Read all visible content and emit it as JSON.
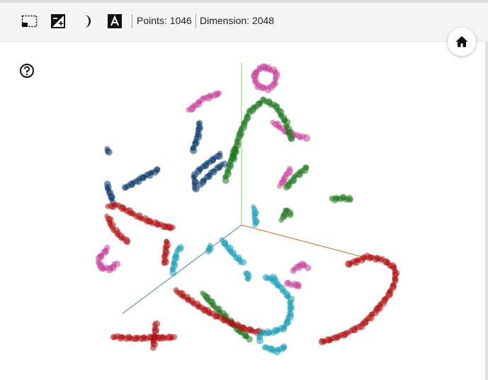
{
  "toolbar": {
    "tools": [
      {
        "name": "selection-icon"
      },
      {
        "name": "contrast-icon"
      },
      {
        "name": "night-mode-icon"
      },
      {
        "name": "labels-icon"
      }
    ],
    "points_label": "Points: 1046",
    "dimension_label": "Dimension: 2048"
  },
  "buttons": {
    "home_icon": "home-icon",
    "help_icon": "help-icon"
  },
  "colors": {
    "axis_x": "#d95f1a",
    "axis_y": "#7ed957",
    "axis_z": "#4a78c9",
    "magenta": "#c8449a",
    "green": "#1f7a1f",
    "navy": "#0d3a6e",
    "red": "#b30f0f",
    "cyan": "#1aa0b8"
  },
  "view": {
    "type": "3d-point-cloud",
    "point_count": 1046,
    "dimension": 2048,
    "clusters": [
      "magenta",
      "green",
      "navy",
      "red",
      "cyan"
    ]
  }
}
